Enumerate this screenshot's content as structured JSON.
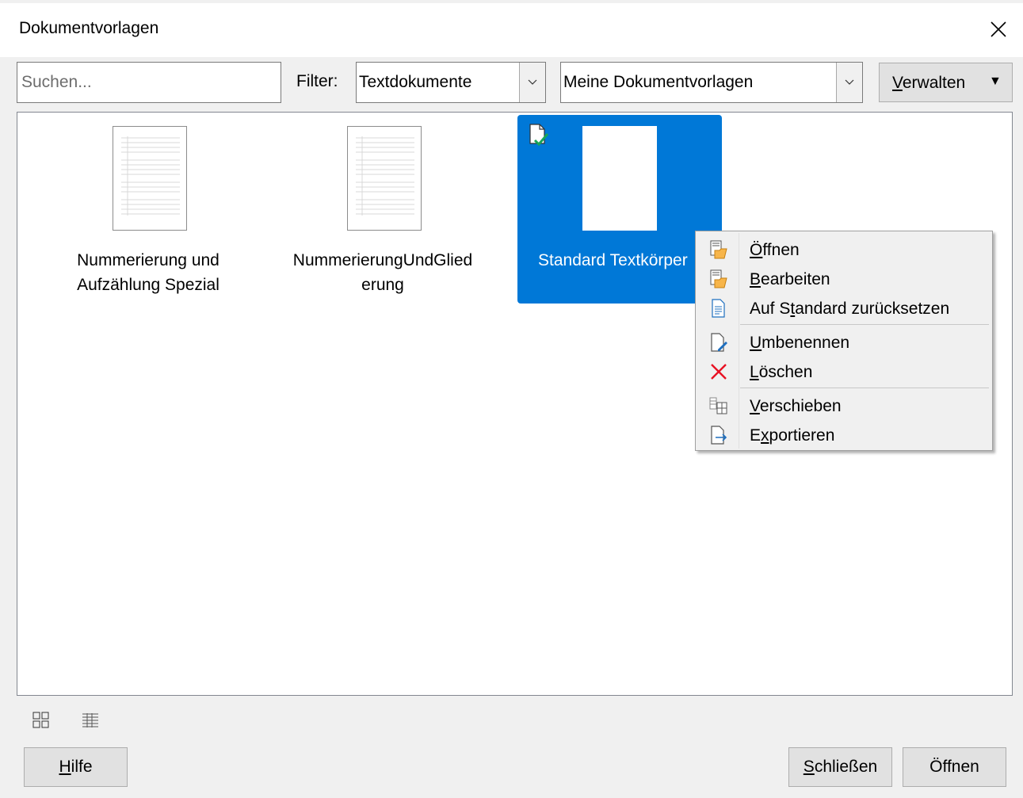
{
  "window": {
    "title": "Dokumentvorlagen"
  },
  "toolbar": {
    "search_placeholder": "Suchen...",
    "filter_label": "Filter:",
    "filter_value": "Textdokumente",
    "category_value": "Meine Dokumentvorlagen",
    "manage_label_first": "V",
    "manage_label_rest": "erwalten"
  },
  "templates": [
    {
      "name_line1": "Nummerierung und",
      "name_line2": "Aufzählung Spezial"
    },
    {
      "name_line1": "NummerierungUndGlied",
      "name_line2": "erung"
    },
    {
      "name": "Standard Textkörper"
    }
  ],
  "context_menu": {
    "items": [
      {
        "pre": "",
        "key": "Ö",
        "post": "ffnen",
        "icon": "open-template-icon"
      },
      {
        "pre": "",
        "key": "B",
        "post": "earbeiten",
        "icon": "edit-template-icon"
      },
      {
        "pre": "Auf S",
        "key": "t",
        "post": "andard zurücksetzen",
        "icon": "reset-default-icon"
      },
      {
        "pre": "",
        "key": "U",
        "post": "mbenennen",
        "icon": "rename-icon"
      },
      {
        "pre": "",
        "key": "L",
        "post": "öschen",
        "icon": "delete-icon"
      },
      {
        "pre": "",
        "key": "V",
        "post": "erschieben",
        "icon": "move-icon"
      },
      {
        "pre": "E",
        "key": "x",
        "post": "portieren",
        "icon": "export-icon"
      }
    ]
  },
  "footer": {
    "help_key": "H",
    "help_rest": "ilfe",
    "close_key": "S",
    "close_rest": "chließen",
    "open_label": "Öffnen"
  },
  "colors": {
    "selection": "#0078d7",
    "delete_red": "#e81123"
  }
}
